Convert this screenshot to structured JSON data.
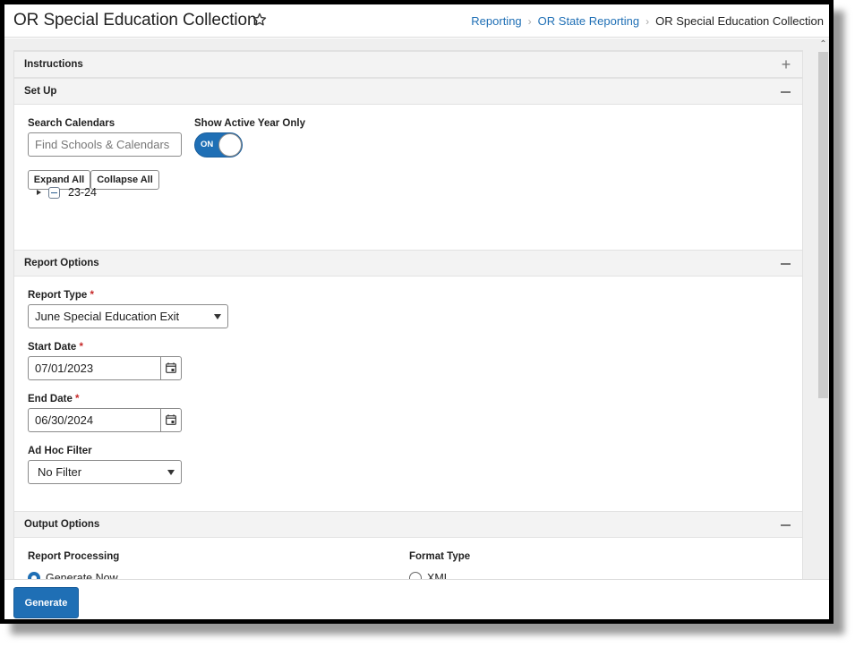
{
  "header": {
    "title": "OR Special Education Collection",
    "favorite_icon": "star-outline-icon",
    "breadcrumb": [
      {
        "label": "Reporting",
        "link": true
      },
      {
        "label": "OR State Reporting",
        "link": true
      },
      {
        "label": "OR Special Education Collection",
        "link": false
      }
    ],
    "breadcrumb_separator": "›"
  },
  "sections": {
    "instructions": {
      "title": "Instructions",
      "toggle": "+",
      "expanded": false
    },
    "setup": {
      "title": "Set Up",
      "toggle": "−",
      "expanded": true,
      "search_label": "Search Calendars",
      "search_placeholder": "Find Schools & Calendars",
      "search_value": "",
      "active_year_label": "Show Active Year Only",
      "active_year_toggle": "ON",
      "expand_all": "Expand All",
      "collapse_all": "Collapse All",
      "tree": [
        {
          "label": "23-24",
          "checked": "partial",
          "expanded": false
        }
      ]
    },
    "report_options": {
      "title": "Report Options",
      "toggle": "−",
      "expanded": true,
      "report_type_label": "Report Type",
      "report_type_value": "June Special Education Exit",
      "start_date_label": "Start Date",
      "start_date_value": "07/01/2023",
      "end_date_label": "End Date",
      "end_date_value": "06/30/2024",
      "ad_hoc_label": "Ad Hoc Filter",
      "ad_hoc_value": "No Filter",
      "required_marker": "*"
    },
    "output_options": {
      "title": "Output Options",
      "toggle": "−",
      "expanded": true,
      "report_processing_label": "Report Processing",
      "report_processing_options": [
        {
          "label": "Generate Now",
          "checked": true
        }
      ],
      "format_type_label": "Format Type",
      "format_type_options": [
        {
          "label": "XML",
          "checked": false
        }
      ]
    }
  },
  "footer": {
    "generate_label": "Generate"
  },
  "colors": {
    "accent": "#1f6fb5",
    "required": "#c62828"
  }
}
